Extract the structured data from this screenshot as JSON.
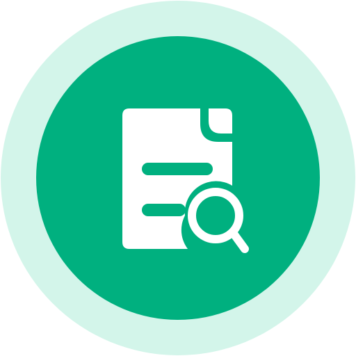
{
  "icon": {
    "name": "document-search-icon",
    "colors": {
      "outer_ring": "#d3f5ea",
      "inner_circle": "#00b07f",
      "glyph": "#ffffff"
    }
  }
}
